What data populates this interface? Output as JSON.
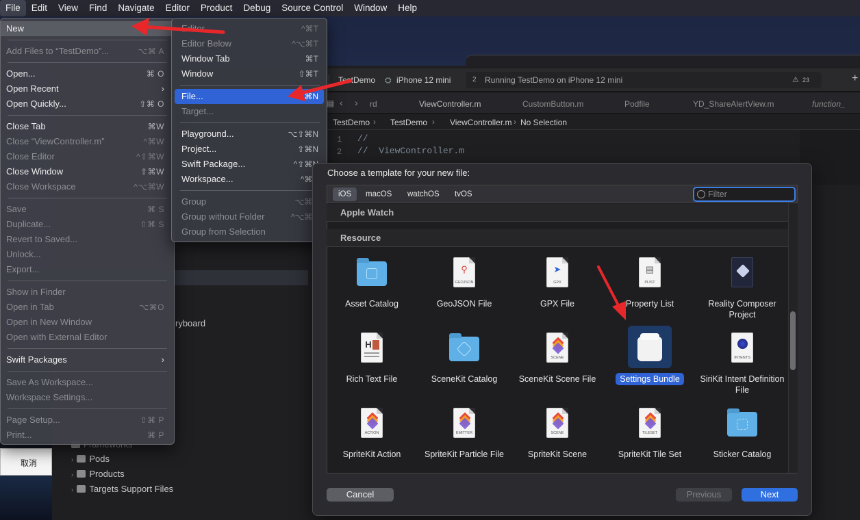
{
  "menubar": {
    "items": [
      "File",
      "Edit",
      "View",
      "Find",
      "Navigate",
      "Editor",
      "Product",
      "Debug",
      "Source Control",
      "Window",
      "Help"
    ]
  },
  "toolbar": {
    "scheme": "TestDemo",
    "device": "iPhone 12 mini",
    "activity_badge": "2",
    "activity": "Running TestDemo on iPhone 12 mini",
    "warning_count": "23"
  },
  "tabs": [
    "rd",
    "ViewController.m",
    "CustomButton.m",
    "Podfile",
    "YD_ShareAlertView.m",
    "function_"
  ],
  "jumpbar": [
    "TestDemo",
    "TestDemo",
    "ViewController.m",
    "No Selection"
  ],
  "editor": {
    "lines": [
      {
        "n": "1",
        "code": "//"
      },
      {
        "n": "2",
        "code": "//  ViewController.m"
      }
    ]
  },
  "navigator": {
    "partial": "ryboard",
    "folders": [
      "Frameworks",
      "Pods",
      "Products",
      "Targets Support Files"
    ]
  },
  "alert": {
    "cancel": "取消"
  },
  "file_menu": {
    "items": [
      {
        "label": "New",
        "shortcut": ""
      },
      {
        "label": "Add Files to “TestDemo”...",
        "shortcut": "⌥⌘ A"
      },
      {
        "label": "Open...",
        "shortcut": "⌘ O"
      },
      {
        "label": "Open Recent",
        "shortcut": ""
      },
      {
        "label": "Open Quickly...",
        "shortcut": "⇧⌘ O"
      },
      {
        "label": "Close Tab",
        "shortcut": "⌘W"
      },
      {
        "label": "Close “ViewController.m”",
        "shortcut": "^⌘W"
      },
      {
        "label": "Close Editor",
        "shortcut": "^⇧⌘W"
      },
      {
        "label": "Close Window",
        "shortcut": "⇧⌘W"
      },
      {
        "label": "Close Workspace",
        "shortcut": "^⌥⌘W"
      },
      {
        "label": "Save",
        "shortcut": "⌘ S"
      },
      {
        "label": "Duplicate...",
        "shortcut": "⇧⌘ S"
      },
      {
        "label": "Revert to Saved...",
        "shortcut": ""
      },
      {
        "label": "Unlock...",
        "shortcut": ""
      },
      {
        "label": "Export...",
        "shortcut": ""
      },
      {
        "label": "Show in Finder",
        "shortcut": ""
      },
      {
        "label": "Open in Tab",
        "shortcut": "⌥⌘O"
      },
      {
        "label": "Open in New Window",
        "shortcut": ""
      },
      {
        "label": "Open with External Editor",
        "shortcut": ""
      },
      {
        "label": "Swift Packages",
        "shortcut": ""
      },
      {
        "label": "Save As Workspace...",
        "shortcut": ""
      },
      {
        "label": "Workspace Settings...",
        "shortcut": ""
      },
      {
        "label": "Page Setup...",
        "shortcut": "⇧⌘ P"
      },
      {
        "label": "Print...",
        "shortcut": "⌘ P"
      }
    ]
  },
  "new_menu": {
    "items": [
      {
        "label": "Editor",
        "shortcut": "^⌘T"
      },
      {
        "label": "Editor Below",
        "shortcut": "^⌥⌘T"
      },
      {
        "label": "Window Tab",
        "shortcut": "⌘T"
      },
      {
        "label": "Window",
        "shortcut": "⇧⌘T"
      },
      {
        "label": "File...",
        "shortcut": "⌘N"
      },
      {
        "label": "Target...",
        "shortcut": ""
      },
      {
        "label": "Playground...",
        "shortcut": "⌥⇧⌘N"
      },
      {
        "label": "Project...",
        "shortcut": "⇧⌘N"
      },
      {
        "label": "Swift Package...",
        "shortcut": "^⇧⌘N"
      },
      {
        "label": "Workspace...",
        "shortcut": "^⌘N"
      },
      {
        "label": "Group",
        "shortcut": "⌥⌘N"
      },
      {
        "label": "Group without Folder",
        "shortcut": "^⌥⌘N"
      },
      {
        "label": "Group from Selection",
        "shortcut": ""
      }
    ]
  },
  "template_sheet": {
    "title": "Choose a template for your new file:",
    "platforms": [
      "iOS",
      "macOS",
      "watchOS",
      "tvOS"
    ],
    "filter_placeholder": "Filter",
    "sections": [
      "Apple Watch",
      "Resource"
    ],
    "templates": [
      {
        "label": "Asset Catalog",
        "icon": "folder-icon"
      },
      {
        "label": "GeoJSON File",
        "icon": "geojson-file-icon",
        "tag": "GEOJSON"
      },
      {
        "label": "GPX File",
        "icon": "gpx-file-icon",
        "tag": "GPX"
      },
      {
        "label": "Property List",
        "icon": "plist-file-icon",
        "tag": "PLIST"
      },
      {
        "label": "Reality Composer Project",
        "icon": "reality-composer-icon"
      },
      {
        "label": "Rich Text File",
        "icon": "rich-text-file-icon"
      },
      {
        "label": "SceneKit Catalog",
        "icon": "folder-icon"
      },
      {
        "label": "SceneKit Scene File",
        "icon": "scene-file-icon",
        "tag": "SCENE"
      },
      {
        "label": "Settings Bundle",
        "icon": "settings-bundle-icon"
      },
      {
        "label": "SiriKit Intent Definition File",
        "icon": "intents-file-icon",
        "tag": "INTENTS"
      },
      {
        "label": "SpriteKit Action",
        "icon": "action-file-icon",
        "tag": "ACTION"
      },
      {
        "label": "SpriteKit Particle File",
        "icon": "emitter-file-icon",
        "tag": "EMITTER"
      },
      {
        "label": "SpriteKit Scene",
        "icon": "scene-file-icon",
        "tag": "SCENE"
      },
      {
        "label": "SpriteKit Tile Set",
        "icon": "tileset-file-icon",
        "tag": "TILESET"
      },
      {
        "label": "Sticker Catalog",
        "icon": "folder-icon"
      }
    ],
    "buttons": {
      "cancel": "Cancel",
      "previous": "Previous",
      "next": "Next"
    }
  },
  "colors": {
    "accent": "#2f63d6",
    "annotation": "#e8272b"
  }
}
